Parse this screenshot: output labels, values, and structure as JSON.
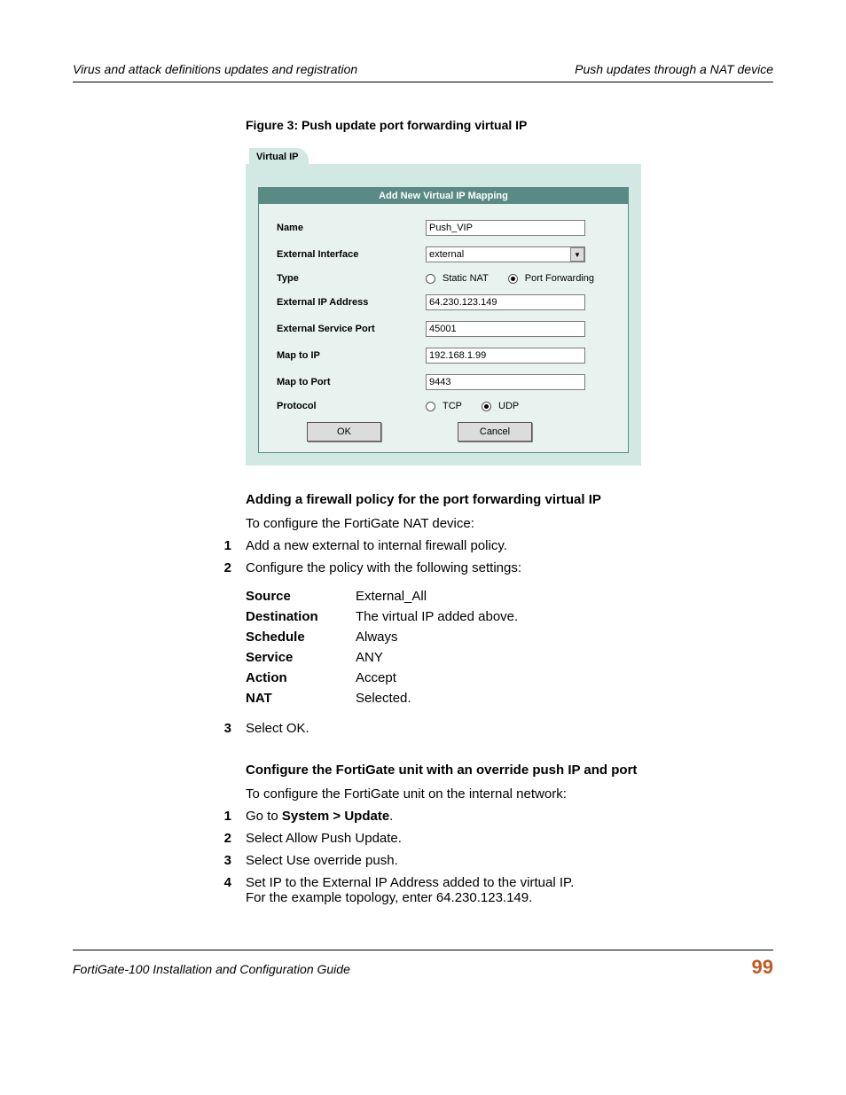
{
  "header": {
    "left": "Virus and attack definitions updates and registration",
    "right": "Push updates through a NAT device"
  },
  "figure": {
    "caption": "Figure 3:   Push update port forwarding virtual IP"
  },
  "vip": {
    "tab": "Virtual IP",
    "panel_title": "Add New Virtual IP Mapping",
    "labels": {
      "name": "Name",
      "ext_if": "External Interface",
      "type": "Type",
      "ext_ip": "External IP Address",
      "ext_port": "External Service Port",
      "map_ip": "Map to IP",
      "map_port": "Map to Port",
      "protocol": "Protocol"
    },
    "values": {
      "name": "Push_VIP",
      "ext_if": "external",
      "ext_ip": "64.230.123.149",
      "ext_port": "45001",
      "map_ip": "192.168.1.99",
      "map_port": "9443"
    },
    "type_options": {
      "static": "Static NAT",
      "pf": "Port Forwarding"
    },
    "protocol_options": {
      "tcp": "TCP",
      "udp": "UDP"
    },
    "buttons": {
      "ok": "OK",
      "cancel": "Cancel"
    }
  },
  "sections": {
    "firewall_heading": "Adding a firewall policy for the port forwarding virtual IP",
    "firewall_intro": "To configure the FortiGate NAT device:",
    "fw_steps": {
      "s1": "Add a new external to internal firewall policy.",
      "s2": "Configure the policy with the following settings:",
      "s3": "Select OK."
    },
    "settings": [
      {
        "k": "Source",
        "v": "External_All"
      },
      {
        "k": "Destination",
        "v": "The virtual IP added above."
      },
      {
        "k": "Schedule",
        "v": "Always"
      },
      {
        "k": "Service",
        "v": "ANY"
      },
      {
        "k": "Action",
        "v": "Accept"
      },
      {
        "k": "NAT",
        "v": "Selected."
      }
    ],
    "override_heading": "Configure the FortiGate unit with an override push IP and port",
    "override_intro": "To configure the FortiGate unit on the internal network:",
    "ov_steps": {
      "s1_prefix": "Go to ",
      "s1_bold": "System > Update",
      "s1_suffix": ".",
      "s2": "Select Allow Push Update.",
      "s3": "Select Use override push.",
      "s4a": "Set IP to the External IP Address added to the virtual IP.",
      "s4b": "For the example topology, enter 64.230.123.149."
    }
  },
  "footer": {
    "left": "FortiGate-100 Installation and Configuration Guide",
    "page": "99"
  }
}
